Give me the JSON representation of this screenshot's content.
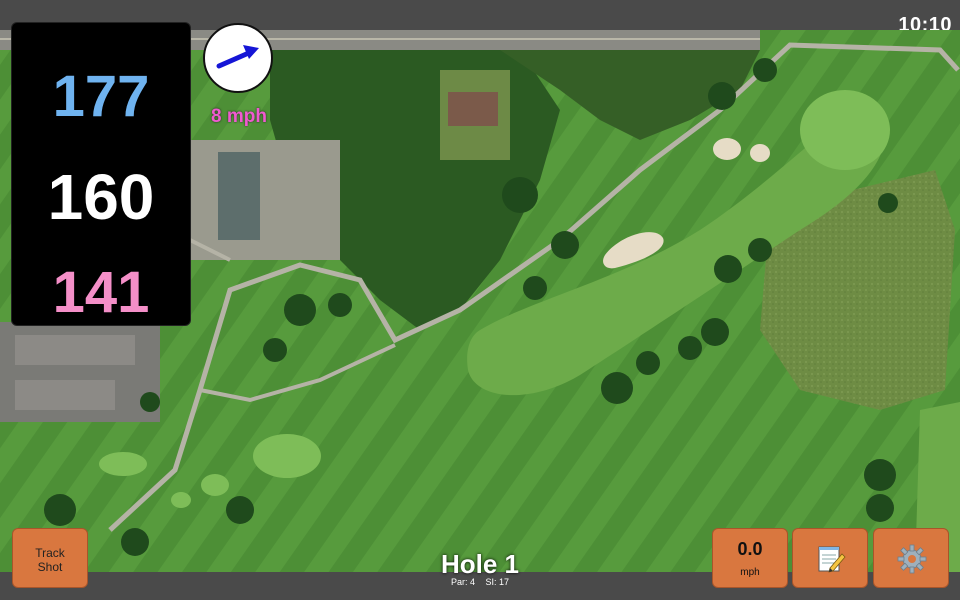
{
  "status": {
    "time": "10:10"
  },
  "distances": {
    "back": "177",
    "middle": "160",
    "front": "141"
  },
  "wind": {
    "speed_label": "8 mph",
    "direction_icon": "arrow-east-northeast-icon"
  },
  "hole": {
    "title": "Hole 1",
    "par": "Par: 4",
    "stroke_index": "SI: 17"
  },
  "buttons": {
    "track_line1": "Track",
    "track_line2": "Shot",
    "wind_value": "0.0",
    "wind_unit": "mph",
    "notes_icon": "notepad-pencil-icon",
    "settings_icon": "gear-icon"
  },
  "colors": {
    "back_distance": "#6fb3f0",
    "middle_distance": "#ffffff",
    "front_distance": "#f48fc8",
    "wind_text": "#f05ad0",
    "button_bg": "#d9773f",
    "bar_bg": "#4a4a4a"
  }
}
